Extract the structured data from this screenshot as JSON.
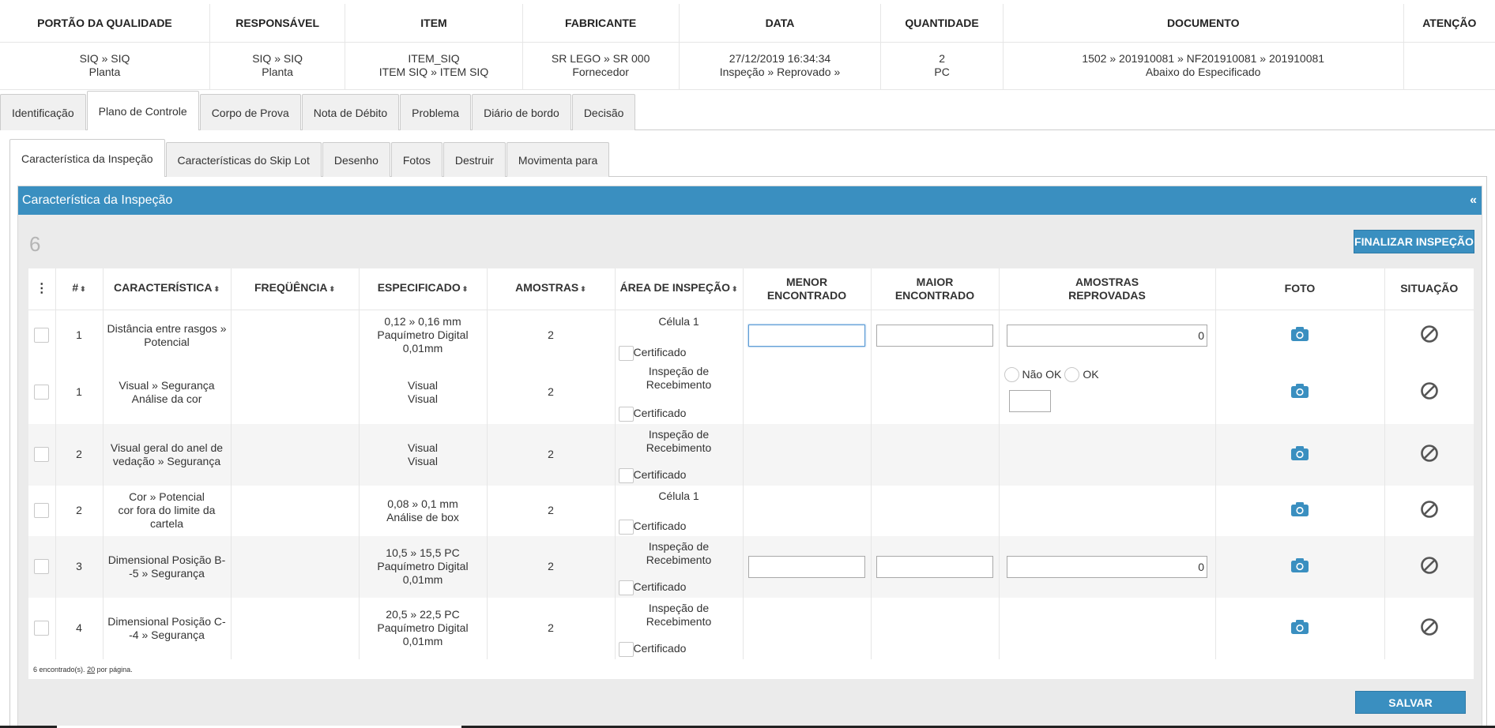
{
  "summary": {
    "headers": [
      "PORTÃO DA QUALIDADE",
      "RESPONSÁVEL",
      "ITEM",
      "FABRICANTE",
      "DATA",
      "QUANTIDADE",
      "DOCUMENTO",
      "ATENÇÃO"
    ],
    "values": [
      [
        "SIQ » SIQ",
        "Planta"
      ],
      [
        "SIQ » SIQ",
        "Planta"
      ],
      [
        "ITEM_SIQ",
        "ITEM SIQ » ITEM SIQ"
      ],
      [
        "SR LEGO » SR 000",
        "Fornecedor"
      ],
      [
        "27/12/2019 16:34:34",
        "Inspeção » Reprovado »"
      ],
      [
        "2",
        "PC"
      ],
      [
        "1502 » 201910081 » NF201910081 » 201910081",
        "Abaixo do Especificado"
      ],
      [
        "",
        ""
      ]
    ]
  },
  "main_tabs": [
    "Identificação",
    "Plano de Controle",
    "Corpo de Prova",
    "Nota de Débito",
    "Problema",
    "Diário de bordo",
    "Decisão"
  ],
  "sub_tabs": [
    "Característica da Inspeção",
    "Características do Skip Lot",
    "Desenho",
    "Fotos",
    "Destruir",
    "Movimenta para"
  ],
  "section": {
    "title": "Característica da Inspeção",
    "collapse": "«",
    "count": "6",
    "finalize_label": "FINALIZAR INSPEÇÃO",
    "save_label": "SALVAR"
  },
  "grid": {
    "columns": {
      "menu": "⋮",
      "num": "#",
      "caracteristica": "CARACTERÍSTICA",
      "frequencia": "FREQÜÊNCIA",
      "especificado": "ESPECIFICADO",
      "amostras": "AMOSTRAS",
      "area": "ÁREA DE INSPEÇÃO",
      "menor_l1": "MENOR",
      "menor_l2": "ENCONTRADO",
      "maior_l1": "MAIOR",
      "maior_l2": "ENCONTRADO",
      "reprov_l1": "AMOSTRAS",
      "reprov_l2": "REPROVADAS",
      "foto": "FOTO",
      "situacao": "SITUAÇÃO"
    },
    "sort_glyph": "⬍",
    "certificado_label": "Certificado",
    "rows": [
      {
        "num": "1",
        "car1": "Distância entre rasgos »",
        "car2": "Potencial",
        "car3": "",
        "spec1": "0,12 » 0,16 mm",
        "spec2": "Paquímetro Digital",
        "spec3": "0,01mm",
        "amostras": "2",
        "area1": "Célula 1",
        "area2": "",
        "reprov_value": "0"
      },
      {
        "num": "1",
        "car1": "Visual » Segurança",
        "car2": "Análise da cor",
        "car3": "",
        "spec1": "Visual",
        "spec2": "Visual",
        "spec3": "",
        "amostras": "2",
        "area1": "Inspeção de",
        "area2": "Recebimento",
        "radio_nok": "Não OK",
        "radio_ok": "OK"
      },
      {
        "num": "2",
        "car1": "Visual geral do anel de",
        "car2": "vedação » Segurança",
        "car3": "",
        "spec1": "Visual",
        "spec2": "Visual",
        "spec3": "",
        "amostras": "2",
        "area1": "Inspeção de",
        "area2": "Recebimento"
      },
      {
        "num": "2",
        "car1": "Cor » Potencial",
        "car2": "cor fora do limite da",
        "car3": "cartela",
        "spec1": "0,08 » 0,1 mm",
        "spec2": "Análise de box",
        "spec3": "",
        "amostras": "2",
        "area1": "Célula 1",
        "area2": ""
      },
      {
        "num": "3",
        "car1": "Dimensional Posição B-",
        "car2": "-5 » Segurança",
        "car3": "",
        "spec1": "10,5 » 15,5 PC",
        "spec2": "Paquímetro Digital",
        "spec3": "0,01mm",
        "amostras": "2",
        "area1": "Inspeção de",
        "area2": "Recebimento",
        "reprov_value": "0"
      },
      {
        "num": "4",
        "car1": "Dimensional Posição C-",
        "car2": "-4 » Segurança",
        "car3": "",
        "spec1": "20,5 » 22,5 PC",
        "spec2": "Paquímetro Digital",
        "spec3": "0,01mm",
        "amostras": "2",
        "area1": "Inspeção de",
        "area2": "Recebimento"
      }
    ],
    "footer_found": "6 encontrado(s).",
    "footer_per_page_num": "20",
    "footer_per_page": " por página."
  },
  "colors": {
    "accent": "#3a8fc0",
    "row_alt": "#f5f5f5"
  },
  "icons": {
    "photo": "camera-icon",
    "status": "ban-icon"
  }
}
